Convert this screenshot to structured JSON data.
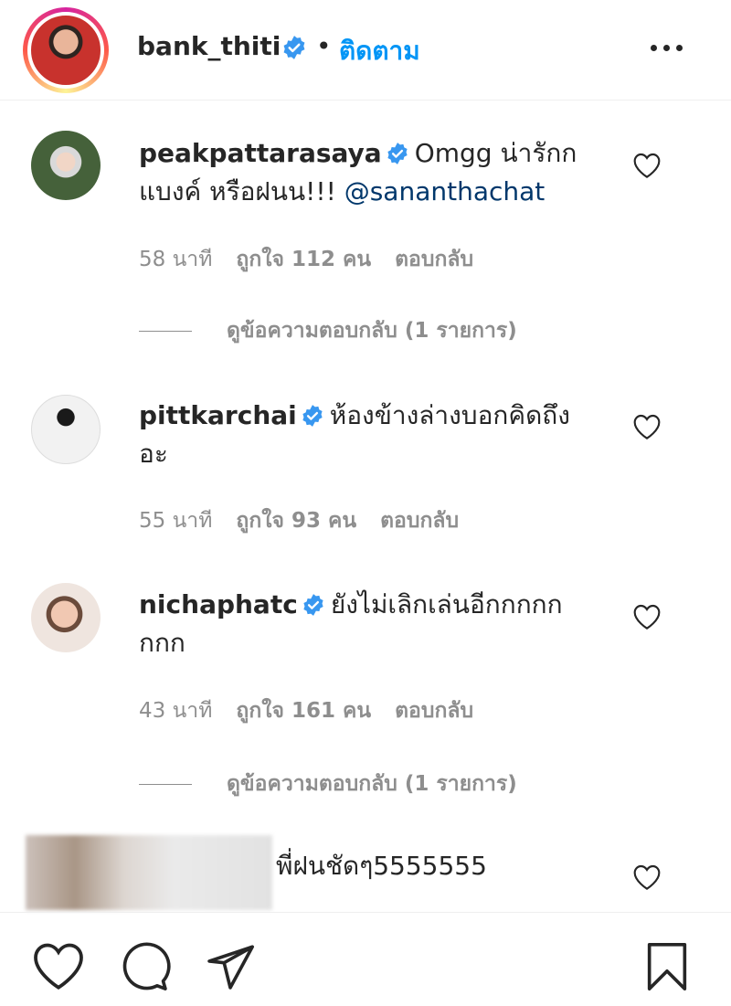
{
  "header": {
    "username": "bank_thiti",
    "separator": "•",
    "follow_label": "ติดตาม"
  },
  "comments": [
    {
      "username": "peakpattarasaya",
      "text": "Omgg น่ารักก แบงค์ หรือฝนน!!! ",
      "mention": "@sananthachat",
      "time": "58 นาที",
      "likes": "ถูกใจ 112 คน",
      "reply": "ตอบกลับ",
      "view_replies": "ดูข้อความตอบกลับ (1 รายการ)"
    },
    {
      "username": "pittkarchai",
      "text": "ห้องข้างล่างบอกคิดถึงอะ",
      "time": "55 นาที",
      "likes": "ถูกใจ 93 คน",
      "reply": "ตอบกลับ"
    },
    {
      "username": "nichaphatc",
      "text": "ยังไม่เลิกเล่นอีกกกกกกกก",
      "time": "43 นาที",
      "likes": "ถูกใจ 161 คน",
      "reply": "ตอบกลับ",
      "view_replies": "ดูข้อความตอบกลับ (1 รายการ)"
    },
    {
      "text": "พี่ฝนชัดๆ5555555"
    }
  ],
  "icons": {
    "verified": "verified-badge-icon",
    "more": "more-options-icon",
    "comment_like": "heart-icon",
    "actions": [
      "like-heart-icon",
      "comment-bubble-icon",
      "share-send-icon",
      "bookmark-icon"
    ]
  },
  "colors": {
    "accent": "#0095f6",
    "verified": "#3897f0",
    "mention": "#00376b",
    "meta": "#8e8e8e",
    "text": "#262626"
  }
}
